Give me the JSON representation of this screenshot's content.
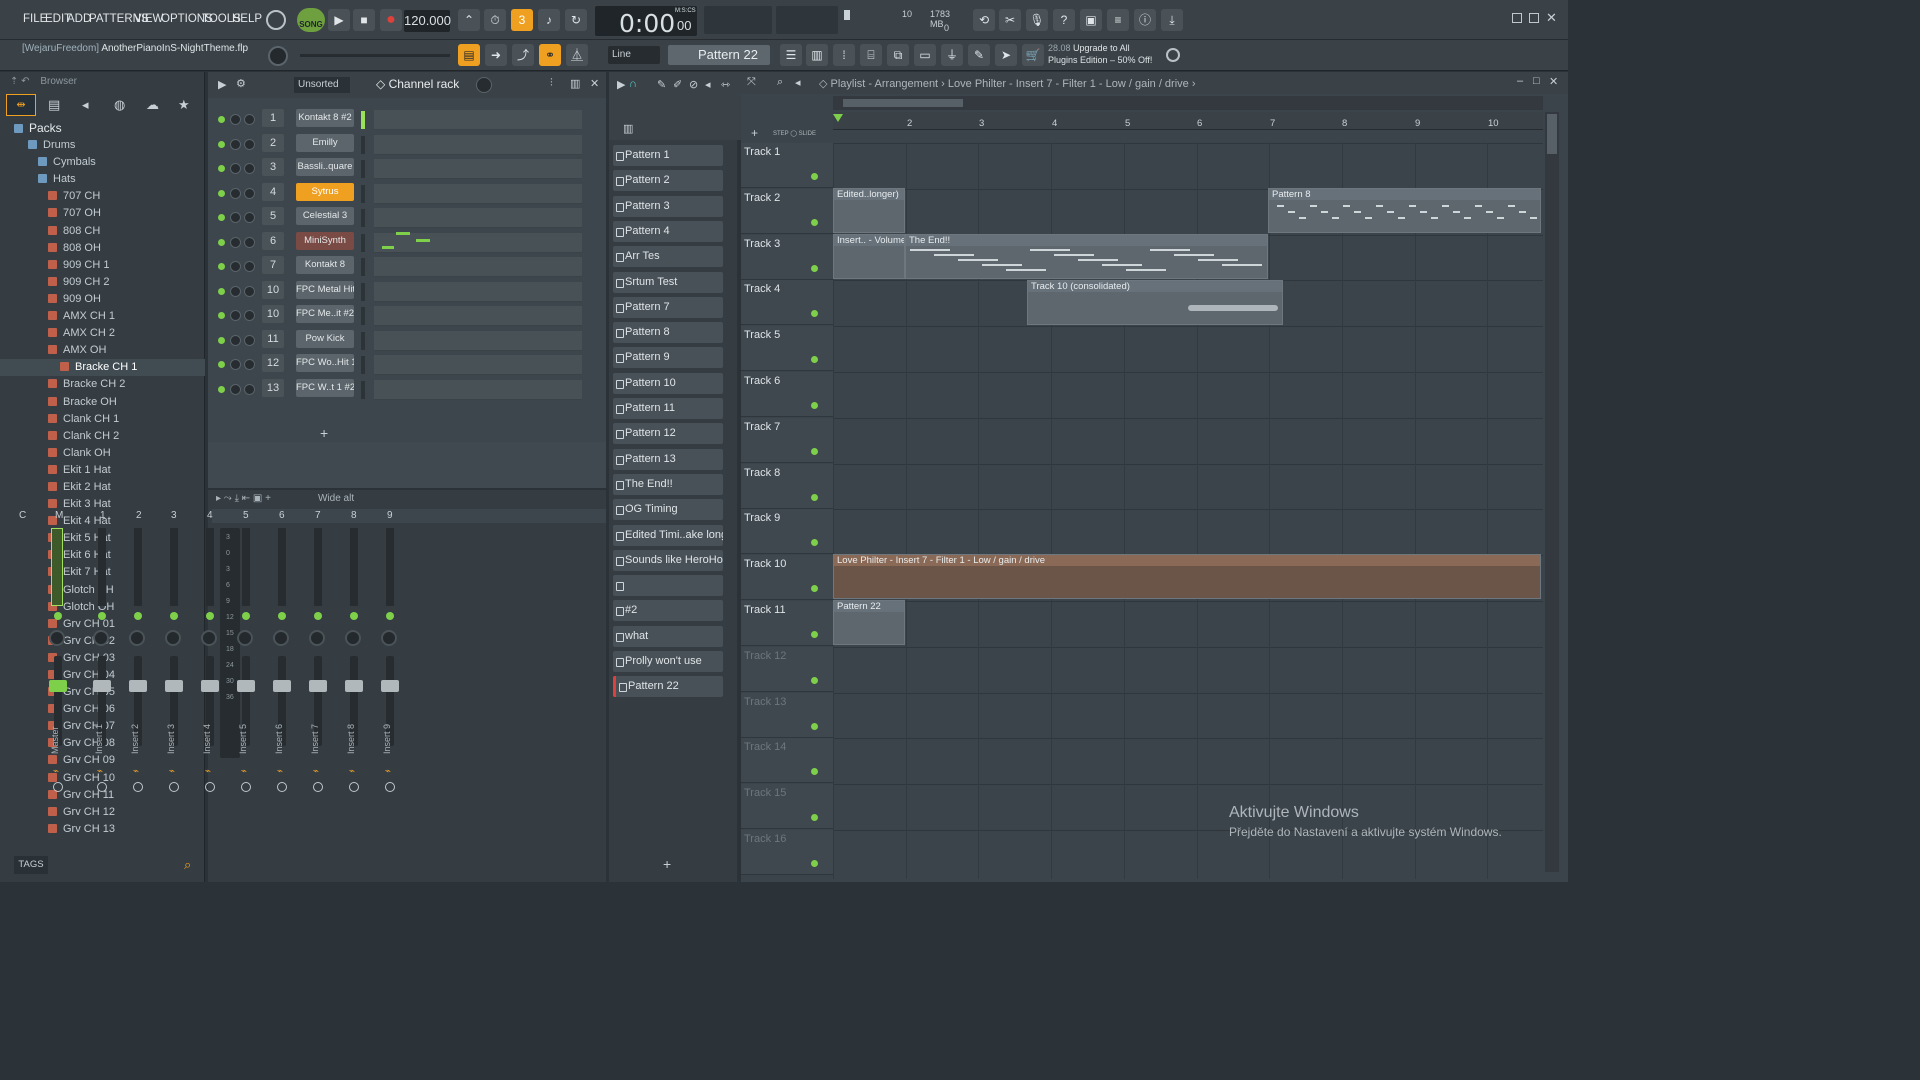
{
  "menu": {
    "items": [
      "FILE",
      "EDIT",
      "ADD",
      "PATTERNS",
      "VIEW",
      "OPTIONS",
      "TOOLS",
      "HELP"
    ]
  },
  "transport": {
    "mode": "SONG",
    "tempo": "120.000",
    "time": "0:00",
    "time_small": "00",
    "time_label": "M:S:CS",
    "cpu_value": "10",
    "mem": "1783 MB",
    "poly": "0"
  },
  "project": {
    "user": "[WejaruFreedom]",
    "file": "AnotherPianoInS-NightTheme.flp"
  },
  "toolbar2": {
    "snap": "Line",
    "pattern": "Pattern 22",
    "promo_date": "28.08",
    "promo_line1": "Upgrade to All",
    "promo_line2": "Plugins Edition – 50% Off!"
  },
  "browser": {
    "title": "Browser",
    "tags_label": "TAGS",
    "tree": [
      {
        "label": "Packs",
        "lvl": 0,
        "kind": "folder"
      },
      {
        "label": "Drums",
        "lvl": 1,
        "kind": "folder"
      },
      {
        "label": "Cymbals",
        "lvl": 2,
        "kind": "folder"
      },
      {
        "label": "Hats",
        "lvl": 2,
        "kind": "folder"
      },
      {
        "label": "707 CH",
        "lvl": 3,
        "kind": "file"
      },
      {
        "label": "707 OH",
        "lvl": 3,
        "kind": "file"
      },
      {
        "label": "808 CH",
        "lvl": 3,
        "kind": "file"
      },
      {
        "label": "808 OH",
        "lvl": 3,
        "kind": "file"
      },
      {
        "label": "909 CH 1",
        "lvl": 3,
        "kind": "file"
      },
      {
        "label": "909 CH 2",
        "lvl": 3,
        "kind": "file"
      },
      {
        "label": "909 OH",
        "lvl": 3,
        "kind": "file"
      },
      {
        "label": "AMX CH 1",
        "lvl": 3,
        "kind": "file"
      },
      {
        "label": "AMX CH 2",
        "lvl": 3,
        "kind": "file"
      },
      {
        "label": "AMX OH",
        "lvl": 3,
        "kind": "file"
      },
      {
        "label": "Bracke CH 1",
        "lvl": 4,
        "kind": "file",
        "selected": true
      },
      {
        "label": "Bracke CH 2",
        "lvl": 3,
        "kind": "file"
      },
      {
        "label": "Bracke OH",
        "lvl": 3,
        "kind": "file"
      },
      {
        "label": "Clank CH 1",
        "lvl": 3,
        "kind": "file"
      },
      {
        "label": "Clank CH 2",
        "lvl": 3,
        "kind": "file"
      },
      {
        "label": "Clank OH",
        "lvl": 3,
        "kind": "file"
      },
      {
        "label": "Ekit 1 Hat",
        "lvl": 3,
        "kind": "file"
      },
      {
        "label": "Ekit 2 Hat",
        "lvl": 3,
        "kind": "file"
      },
      {
        "label": "Ekit 3 Hat",
        "lvl": 3,
        "kind": "file"
      },
      {
        "label": "Ekit 4 Hat",
        "lvl": 3,
        "kind": "file"
      },
      {
        "label": "Ekit 5 Hat",
        "lvl": 3,
        "kind": "file"
      },
      {
        "label": "Ekit 6 Hat",
        "lvl": 3,
        "kind": "file"
      },
      {
        "label": "Ekit 7 Hat",
        "lvl": 3,
        "kind": "file"
      },
      {
        "label": "Glotch CH",
        "lvl": 3,
        "kind": "file"
      },
      {
        "label": "Glotch OH",
        "lvl": 3,
        "kind": "file"
      },
      {
        "label": "Grv CH 01",
        "lvl": 3,
        "kind": "file"
      },
      {
        "label": "Grv CH 02",
        "lvl": 3,
        "kind": "file"
      },
      {
        "label": "Grv CH 03",
        "lvl": 3,
        "kind": "file"
      },
      {
        "label": "Grv CH 04",
        "lvl": 3,
        "kind": "file"
      },
      {
        "label": "Grv CH 05",
        "lvl": 3,
        "kind": "file"
      },
      {
        "label": "Grv CH 06",
        "lvl": 3,
        "kind": "file"
      },
      {
        "label": "Grv CH 07",
        "lvl": 3,
        "kind": "file"
      },
      {
        "label": "Grv CH 08",
        "lvl": 3,
        "kind": "file"
      },
      {
        "label": "Grv CH 09",
        "lvl": 3,
        "kind": "file"
      },
      {
        "label": "Grv CH 10",
        "lvl": 3,
        "kind": "file"
      },
      {
        "label": "Grv CH 11",
        "lvl": 3,
        "kind": "file"
      },
      {
        "label": "Grv CH 12",
        "lvl": 3,
        "kind": "file"
      },
      {
        "label": "Grv CH 13",
        "lvl": 3,
        "kind": "file"
      }
    ]
  },
  "channel_rack": {
    "title": "Channel rack",
    "filter": "Unsorted",
    "channels": [
      {
        "num": "1",
        "name": "Kontakt 8 #2",
        "style": "normal"
      },
      {
        "num": "2",
        "name": "Emilly",
        "style": "normal"
      },
      {
        "num": "3",
        "name": "Bassli..quare",
        "style": "normal"
      },
      {
        "num": "4",
        "name": "Sytrus",
        "style": "orange"
      },
      {
        "num": "5",
        "name": "Celestial 3",
        "style": "normal"
      },
      {
        "num": "6",
        "name": "MiniSynth",
        "style": "red"
      },
      {
        "num": "7",
        "name": "Kontakt 8",
        "style": "normal"
      },
      {
        "num": "10",
        "name": "FPC Metal Hit",
        "style": "normal"
      },
      {
        "num": "10",
        "name": "FPC Me..it #2",
        "style": "normal"
      },
      {
        "num": "11",
        "name": "Pow Kick",
        "style": "normal"
      },
      {
        "num": "12",
        "name": "FPC Wo..Hit 1",
        "style": "normal"
      },
      {
        "num": "13",
        "name": "FPC W..t 1 #2",
        "style": "normal"
      }
    ]
  },
  "mixer": {
    "preset": "Wide alt",
    "header": [
      "C",
      "M",
      "1",
      "2",
      "3",
      "4",
      "5",
      "6",
      "7",
      "8",
      "9"
    ],
    "strips": [
      "Master",
      "Insert 1",
      "Insert 2",
      "Insert 3",
      "Insert 4",
      "Insert 5",
      "Insert 6",
      "Insert 7",
      "Insert 8",
      "Insert 9"
    ],
    "db_scale": [
      "3",
      "0",
      "3",
      "6",
      "9",
      "12",
      "15",
      "18",
      "24",
      "30",
      "36"
    ]
  },
  "picker": {
    "items": [
      "Pattern 1",
      "Pattern 2",
      "Pattern 3",
      "Pattern 4",
      "Arr Tes",
      "Srtum Test",
      "Pattern 7",
      "Pattern 8",
      "Pattern 9",
      "Pattern 10",
      "Pattern 11",
      "Pattern 12",
      "Pattern 13",
      "The End!!",
      "OG Timing",
      "Edited Timi..ake longer)",
      "Sounds like HeroHotel",
      "",
      "#2",
      "what",
      "Prolly won't use",
      "Pattern 22"
    ]
  },
  "playlist": {
    "title": "Playlist - Arrangement",
    "breadcrumb": "Love Philter - Insert 7 - Filter 1 - Low / gain / drive",
    "step_label": "STEP",
    "slide_label": "SLIDE",
    "ruler": [
      "2",
      "3",
      "4",
      "5",
      "6",
      "7",
      "8",
      "9",
      "10"
    ],
    "tracks": [
      "Track 1",
      "Track 2",
      "Track 3",
      "Track 4",
      "Track 5",
      "Track 6",
      "Track 7",
      "Track 8",
      "Track 9",
      "Track 10",
      "Track 11",
      "Track 12",
      "Track 13",
      "Track 14",
      "Track 15",
      "Track 16"
    ],
    "clips": {
      "t2a": "Edited..longer)",
      "t2b": "Pattern 8",
      "t3a": "Insert.. - Volume",
      "t3b": "The End!!",
      "t4": "Track 10 (consolidated)",
      "t10": "Love Philter - Insert 7 - Filter 1 - Low / gain / drive",
      "t11": "Pattern 22"
    }
  },
  "watermark": {
    "line1": "Aktivujte Windows",
    "line2": "Přejděte do Nastavení a aktivujte systém Windows."
  },
  "colors": {
    "accent": "#f0a020",
    "green_led": "#7ed04a",
    "bg": "#2b3339"
  }
}
